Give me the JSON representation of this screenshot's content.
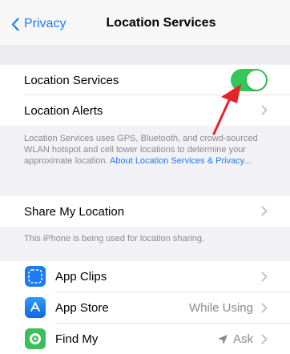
{
  "nav": {
    "back_label": "Privacy",
    "title": "Location Services"
  },
  "location_section": {
    "location_services_label": "Location Services",
    "location_services_enabled": true,
    "location_alerts_label": "Location Alerts",
    "footnote_text": "Location Services uses GPS, Bluetooth, and crowd-sourced WLAN hotspot and cell tower locations to determine your approximate location. ",
    "footnote_link": "About Location Services & Privacy..."
  },
  "share_section": {
    "share_label": "Share My Location",
    "footnote_text": "This iPhone is being used for location sharing."
  },
  "apps": [
    {
      "name": "App Clips",
      "value": "",
      "icon": "app-clips-icon"
    },
    {
      "name": "App Store",
      "value": "While Using",
      "icon": "app-store-icon"
    },
    {
      "name": "Find My",
      "value": "Ask",
      "icon": "find-my-icon"
    }
  ],
  "colors": {
    "accent": "#1d7cf2",
    "toggle_on": "#34c759",
    "annotation_arrow": "#e8242b"
  }
}
